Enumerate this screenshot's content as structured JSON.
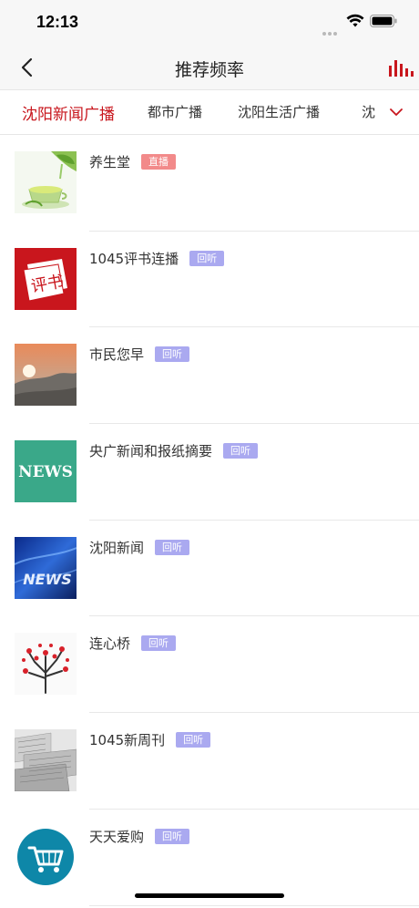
{
  "status": {
    "time": "12:13"
  },
  "header": {
    "title": "推荐频率"
  },
  "tabs": [
    {
      "label": "沈阳新闻广播",
      "active": true
    },
    {
      "label": "都市广播",
      "active": false
    },
    {
      "label": "沈阳生活广播",
      "active": false
    },
    {
      "label": "沈",
      "active": false
    }
  ],
  "items": [
    {
      "title": "养生堂",
      "badge": "直播",
      "badge_type": "live",
      "thumb": "tea-thumbnail"
    },
    {
      "title": "1045评书连播",
      "badge": "回听",
      "badge_type": "replay",
      "thumb": "pingshu-thumbnail",
      "thumb_text": "评书"
    },
    {
      "title": "市民您早",
      "badge": "回听",
      "badge_type": "replay",
      "thumb": "sunrise-thumbnail"
    },
    {
      "title": "央广新闻和报纸摘要",
      "badge": "回听",
      "badge_type": "replay",
      "thumb": "news-thumbnail",
      "thumb_text": "NEWS"
    },
    {
      "title": "沈阳新闻",
      "badge": "回听",
      "badge_type": "replay",
      "thumb": "blue-news-thumbnail",
      "thumb_text": "NEWS"
    },
    {
      "title": "连心桥",
      "badge": "回听",
      "badge_type": "replay",
      "thumb": "heart-tree-thumbnail"
    },
    {
      "title": "1045新周刊",
      "badge": "回听",
      "badge_type": "replay",
      "thumb": "newspaper-thumbnail"
    },
    {
      "title": "天天爱购",
      "badge": "回听",
      "badge_type": "replay",
      "thumb": "shopping-cart-thumbnail"
    }
  ],
  "colors": {
    "accent": "#c8161d",
    "live_badge": "#f28a8a",
    "replay_badge": "#aaa9f0"
  }
}
